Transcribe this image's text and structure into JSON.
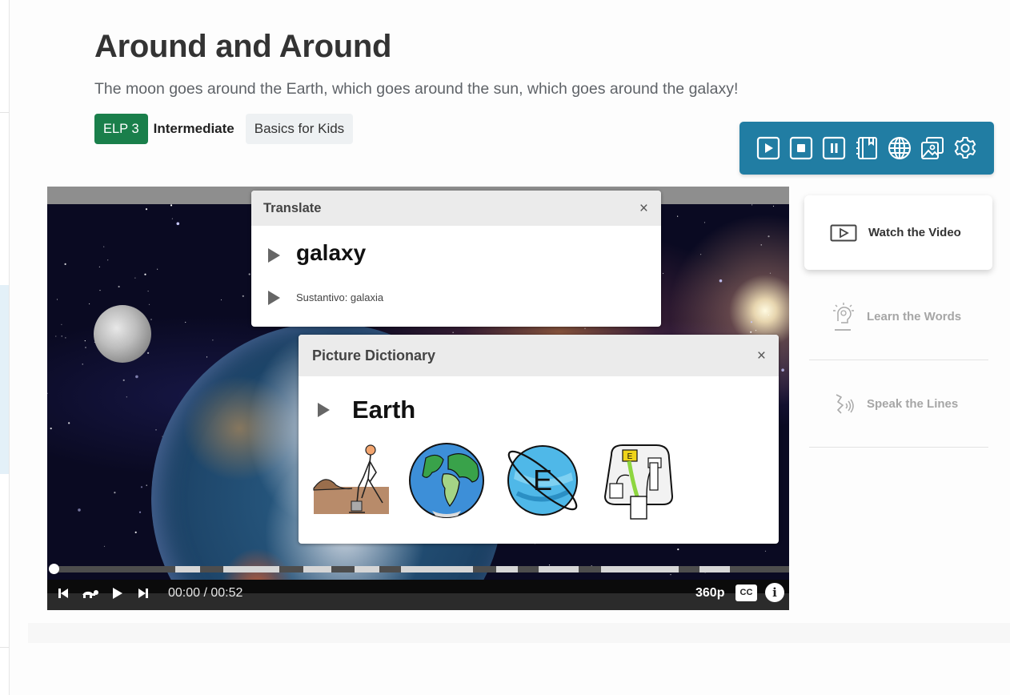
{
  "lesson": {
    "title": "Around and Around",
    "subtitle": "The moon goes around the Earth, which goes around the sun, which goes around the galaxy!",
    "level_badge": "ELP 3",
    "level_name": "Intermediate",
    "course_tag": "Basics for Kids"
  },
  "toolbar": {
    "background": "#217da3",
    "buttons": [
      {
        "name": "play-icon",
        "label": "Play"
      },
      {
        "name": "stop-icon",
        "label": "Stop"
      },
      {
        "name": "pause-icon",
        "label": "Pause"
      },
      {
        "name": "dictionary-icon",
        "label": "Dictionary"
      },
      {
        "name": "translate-globe-icon",
        "label": "Translate"
      },
      {
        "name": "picture-dictionary-icon",
        "label": "Picture Dictionary"
      },
      {
        "name": "settings-icon",
        "label": "Settings"
      }
    ]
  },
  "video": {
    "time_current": "00:00",
    "time_total": "00:52",
    "time_display": "00:00 / 00:52",
    "quality": "360p",
    "cc_label": "CC",
    "info_label": "i",
    "progress_fraction": 0.0,
    "caption_segments": [
      [
        0.166,
        0.2
      ],
      [
        0.232,
        0.308
      ],
      [
        0.34,
        0.378
      ],
      [
        0.41,
        0.443
      ],
      [
        0.473,
        0.571
      ],
      [
        0.602,
        0.632
      ],
      [
        0.66,
        0.714
      ],
      [
        0.745,
        0.85
      ],
      [
        0.878,
        0.92
      ]
    ]
  },
  "translate_popup": {
    "title": "Translate",
    "word": "galaxy",
    "definition": "Sustantivo: galaxia",
    "close": "×"
  },
  "picture_dictionary": {
    "title": "Picture Dictionary",
    "word": "Earth",
    "close": "×",
    "images": [
      "earth-soil-digging",
      "earth-globe",
      "earth-planet-e",
      "earth-wire-plug"
    ]
  },
  "steps": {
    "watch": "Watch the Video",
    "learn": "Learn the Words",
    "speak": "Speak the Lines"
  },
  "colors": {
    "elp_badge": "#1a7f4b",
    "toolbar": "#217da3",
    "inactive_text": "#a6a6a6"
  }
}
